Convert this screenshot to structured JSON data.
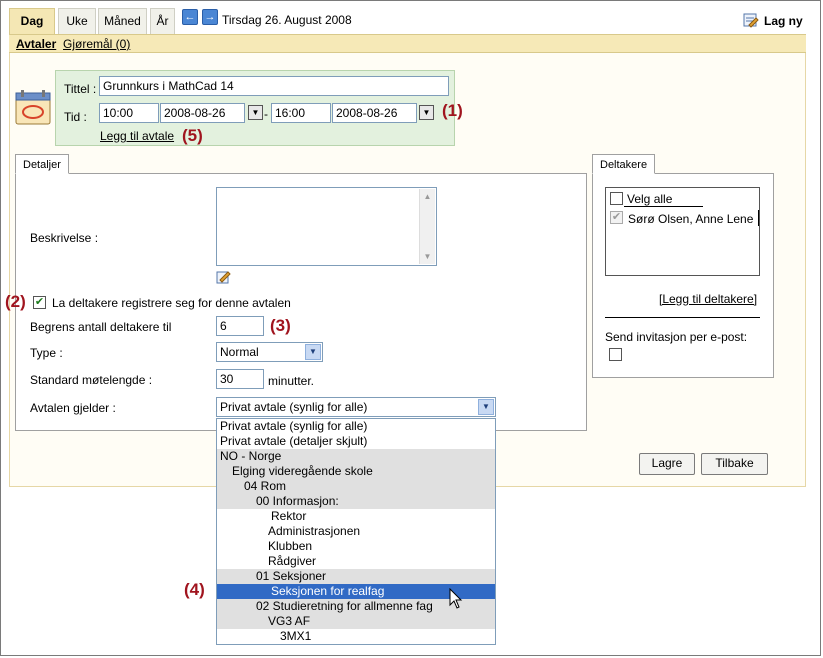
{
  "tabs": [
    {
      "label": "Dag",
      "active": true
    },
    {
      "label": "Uke"
    },
    {
      "label": "Måned"
    },
    {
      "label": "År"
    }
  ],
  "nav": {
    "prev_icon": "arrow-left-icon",
    "next_icon": "arrow-right-icon",
    "date": "Tirsdag 26. August 2008"
  },
  "lag_ny": "Lag ny",
  "subtabs": {
    "avtaler": "Avtaler",
    "gjoremal": "Gjøremål (0)"
  },
  "form": {
    "tittel_label": "Tittel :",
    "tittel_value": "Grunnkurs i MathCad 14",
    "tid_label": "Tid :",
    "start_time": "10:00",
    "start_date": "2008-08-26",
    "separator": "-",
    "end_time": "16:00",
    "end_date": "2008-08-26",
    "legg_til_avtale": "Legg til avtale"
  },
  "callouts": {
    "c1": "(1)",
    "c2": "(2)",
    "c3": "(3)",
    "c4": "(4)",
    "c5": "(5)"
  },
  "detaljer": {
    "tab": "Detaljer",
    "beskrivelse_label": "Beskrivelse :",
    "register_label": "La deltakere registrere seg for denne avtalen",
    "register_checked": true,
    "begrens_label": "Begrens antall deltakere til",
    "begrens_value": "6",
    "type_label": "Type :",
    "type_value": "Normal",
    "motelengde_label": "Standard møtelengde :",
    "motelengde_value": "30",
    "minutter": "minutter.",
    "gjelder_label": "Avtalen gjelder :",
    "gjelder_value": "Privat avtale (synlig for alle)"
  },
  "dropdown_options": [
    {
      "label": "Privat avtale (synlig for alle)",
      "style": "plain"
    },
    {
      "label": "Privat avtale (detaljer skjult)",
      "style": "plain"
    },
    {
      "label": "NO - Norge",
      "style": "gray"
    },
    {
      "label": "Elging videregående skole",
      "style": "gray"
    },
    {
      "label": "04 Rom",
      "style": "gray"
    },
    {
      "label": "00 Informasjon:",
      "style": "gray"
    },
    {
      "label": "Rektor",
      "style": "plain"
    },
    {
      "label": "Administrasjonen",
      "style": "plain"
    },
    {
      "label": "Klubben",
      "style": "plain"
    },
    {
      "label": "Rådgiver",
      "style": "plain"
    },
    {
      "label": "01 Seksjoner",
      "style": "gray"
    },
    {
      "label": "Seksjonen for realfag",
      "style": "selected"
    },
    {
      "label": "02 Studieretning for allmenne fag",
      "style": "gray"
    },
    {
      "label": "VG3 AF",
      "style": "gray"
    },
    {
      "label": "3MX1",
      "style": "plain"
    }
  ],
  "deltakere": {
    "tab": "Deltakere",
    "velg_alle": "Velg alle",
    "participant": "Sørø Olsen, Anne Lene",
    "legg_til": "[Legg til deltakere]",
    "send_label": "Send invitasjon per e-post:"
  },
  "buttons": {
    "lagre": "Lagre",
    "tilbake": "Tilbake"
  }
}
